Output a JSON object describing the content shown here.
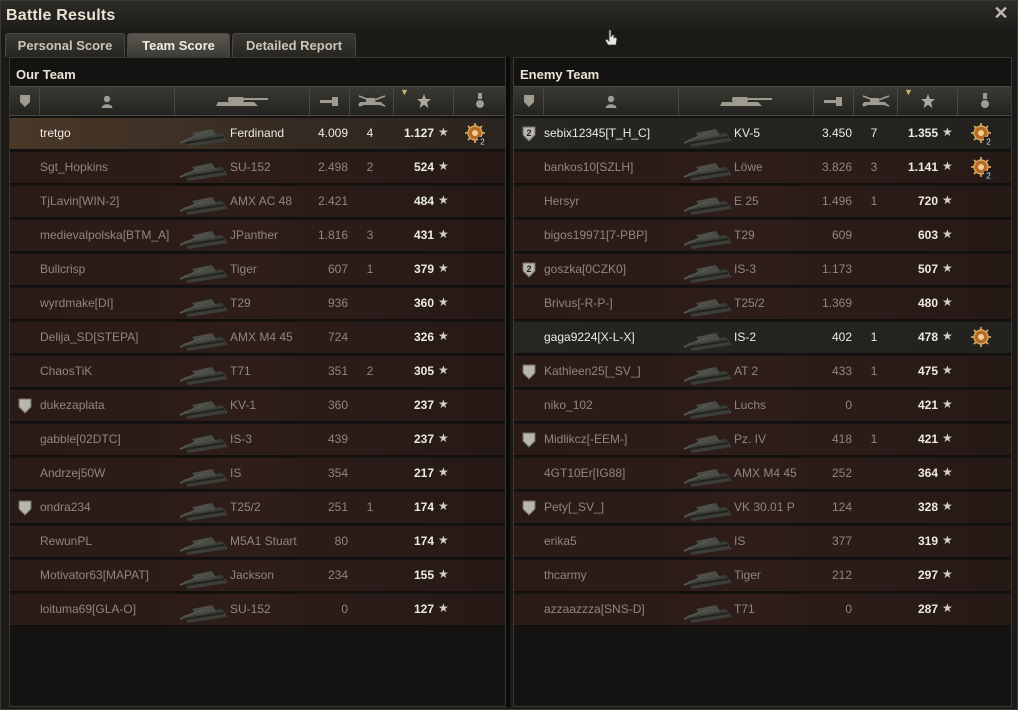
{
  "window": {
    "title": "Battle Results"
  },
  "tabs": [
    {
      "label": "Personal Score",
      "active": false
    },
    {
      "label": "Team Score",
      "active": true
    },
    {
      "label": "Detailed Report",
      "active": false
    }
  ],
  "our_team": {
    "title": "Our Team",
    "players": [
      {
        "name": "tretgo",
        "tank": "Ferdinand",
        "damage": "4.009",
        "kills": "4",
        "xp": "1.127",
        "platoon": false,
        "medal": "2",
        "state": "self"
      },
      {
        "name": "Sgt_Hopkins",
        "tank": "SU-152",
        "damage": "2.498",
        "kills": "2",
        "xp": "524",
        "platoon": false,
        "medal": "",
        "state": "dead"
      },
      {
        "name": "TjLavin[WIN-2]",
        "tank": "AMX AC 48",
        "damage": "2.421",
        "kills": "",
        "xp": "484",
        "platoon": false,
        "medal": "",
        "state": "dead"
      },
      {
        "name": "medievalpolska[BTM_A]",
        "tank": "JPanther",
        "damage": "1.816",
        "kills": "3",
        "xp": "431",
        "platoon": false,
        "medal": "",
        "state": "dead"
      },
      {
        "name": "Bullcrisp",
        "tank": "Tiger",
        "damage": "607",
        "kills": "1",
        "xp": "379",
        "platoon": false,
        "medal": "",
        "state": "dead"
      },
      {
        "name": "wyrdmake[DI]",
        "tank": "T29",
        "damage": "936",
        "kills": "",
        "xp": "360",
        "platoon": false,
        "medal": "",
        "state": "dead"
      },
      {
        "name": "Delija_SD[STEPA]",
        "tank": "AMX M4 45",
        "damage": "724",
        "kills": "",
        "xp": "326",
        "platoon": false,
        "medal": "",
        "state": "dead"
      },
      {
        "name": "ChaosTiK",
        "tank": "T71",
        "damage": "351",
        "kills": "2",
        "xp": "305",
        "platoon": false,
        "medal": "",
        "state": "dead"
      },
      {
        "name": "dukezaplata",
        "tank": "KV-1",
        "damage": "360",
        "kills": "",
        "xp": "237",
        "platoon": true,
        "medal": "",
        "state": "dead"
      },
      {
        "name": "gabble[02DTC]",
        "tank": "IS-3",
        "damage": "439",
        "kills": "",
        "xp": "237",
        "platoon": false,
        "medal": "",
        "state": "dead"
      },
      {
        "name": "Andrzej50W",
        "tank": "IS",
        "damage": "354",
        "kills": "",
        "xp": "217",
        "platoon": false,
        "medal": "",
        "state": "dead"
      },
      {
        "name": "ondra234",
        "tank": "T25/2",
        "damage": "251",
        "kills": "1",
        "xp": "174",
        "platoon": true,
        "medal": "",
        "state": "dead"
      },
      {
        "name": "RewunPL",
        "tank": "M5A1 Stuart",
        "damage": "80",
        "kills": "",
        "xp": "174",
        "platoon": false,
        "medal": "",
        "state": "dead"
      },
      {
        "name": "Motivator63[MAPAT]",
        "tank": "Jackson",
        "damage": "234",
        "kills": "",
        "xp": "155",
        "platoon": false,
        "medal": "",
        "state": "dead"
      },
      {
        "name": "loituma69[GLA-O]",
        "tank": "SU-152",
        "damage": "0",
        "kills": "",
        "xp": "127",
        "platoon": false,
        "medal": "",
        "state": "dead"
      }
    ]
  },
  "enemy_team": {
    "title": "Enemy Team",
    "players": [
      {
        "name": "sebix12345[T_H_C]",
        "tank": "KV-5",
        "damage": "3.450",
        "kills": "7",
        "xp": "1.355",
        "platoon": true,
        "platoon_num": "2",
        "medal": "2",
        "state": "alive"
      },
      {
        "name": "bankos10[SZLH]",
        "tank": "Löwe",
        "damage": "3.826",
        "kills": "3",
        "xp": "1.141",
        "platoon": false,
        "medal": "2",
        "state": "dead"
      },
      {
        "name": "Hersyr",
        "tank": "E 25",
        "damage": "1.496",
        "kills": "1",
        "xp": "720",
        "platoon": false,
        "medal": "",
        "state": "dead"
      },
      {
        "name": "bigos19971[7-PBP]",
        "tank": "T29",
        "damage": "609",
        "kills": "",
        "xp": "603",
        "platoon": false,
        "medal": "",
        "state": "dead"
      },
      {
        "name": "goszka[0CZK0]",
        "tank": "IS-3",
        "damage": "1.173",
        "kills": "",
        "xp": "507",
        "platoon": true,
        "platoon_num": "2",
        "medal": "",
        "state": "dead"
      },
      {
        "name": "Brivus[-R-P-]",
        "tank": "T25/2",
        "damage": "1.369",
        "kills": "",
        "xp": "480",
        "platoon": false,
        "medal": "",
        "state": "dead"
      },
      {
        "name": "gaga9224[X-L-X]",
        "tank": "IS-2",
        "damage": "402",
        "kills": "1",
        "xp": "478",
        "platoon": false,
        "medal": "1",
        "state": "alive"
      },
      {
        "name": "Kathleen25[_SV_]",
        "tank": "AT 2",
        "damage": "433",
        "kills": "1",
        "xp": "475",
        "platoon": true,
        "medal": "",
        "state": "dead"
      },
      {
        "name": "niko_102",
        "tank": "Luchs",
        "damage": "0",
        "kills": "",
        "xp": "421",
        "platoon": false,
        "medal": "",
        "state": "dead"
      },
      {
        "name": "Midlikcz[-EEM-]",
        "tank": "Pz. IV",
        "damage": "418",
        "kills": "1",
        "xp": "421",
        "platoon": true,
        "medal": "",
        "state": "dead"
      },
      {
        "name": "4GT10Er[IG88]",
        "tank": "AMX M4 45",
        "damage": "252",
        "kills": "",
        "xp": "364",
        "platoon": false,
        "medal": "",
        "state": "dead"
      },
      {
        "name": "Pety[_SV_]",
        "tank": "VK 30.01 P",
        "damage": "124",
        "kills": "",
        "xp": "328",
        "platoon": true,
        "medal": "",
        "state": "dead"
      },
      {
        "name": "erika5",
        "tank": "IS",
        "damage": "377",
        "kills": "",
        "xp": "319",
        "platoon": false,
        "medal": "",
        "state": "dead"
      },
      {
        "name": "thcarmy",
        "tank": "Tiger",
        "damage": "212",
        "kills": "",
        "xp": "297",
        "platoon": false,
        "medal": "",
        "state": "dead"
      },
      {
        "name": "azzaazzza[SNS-D]",
        "tank": "T71",
        "damage": "0",
        "kills": "",
        "xp": "287",
        "platoon": false,
        "medal": "",
        "state": "dead"
      }
    ]
  },
  "colors": {
    "alive_text": "#ecebe2",
    "dead_text": "#8f877d",
    "self_row": "#4a3829"
  }
}
